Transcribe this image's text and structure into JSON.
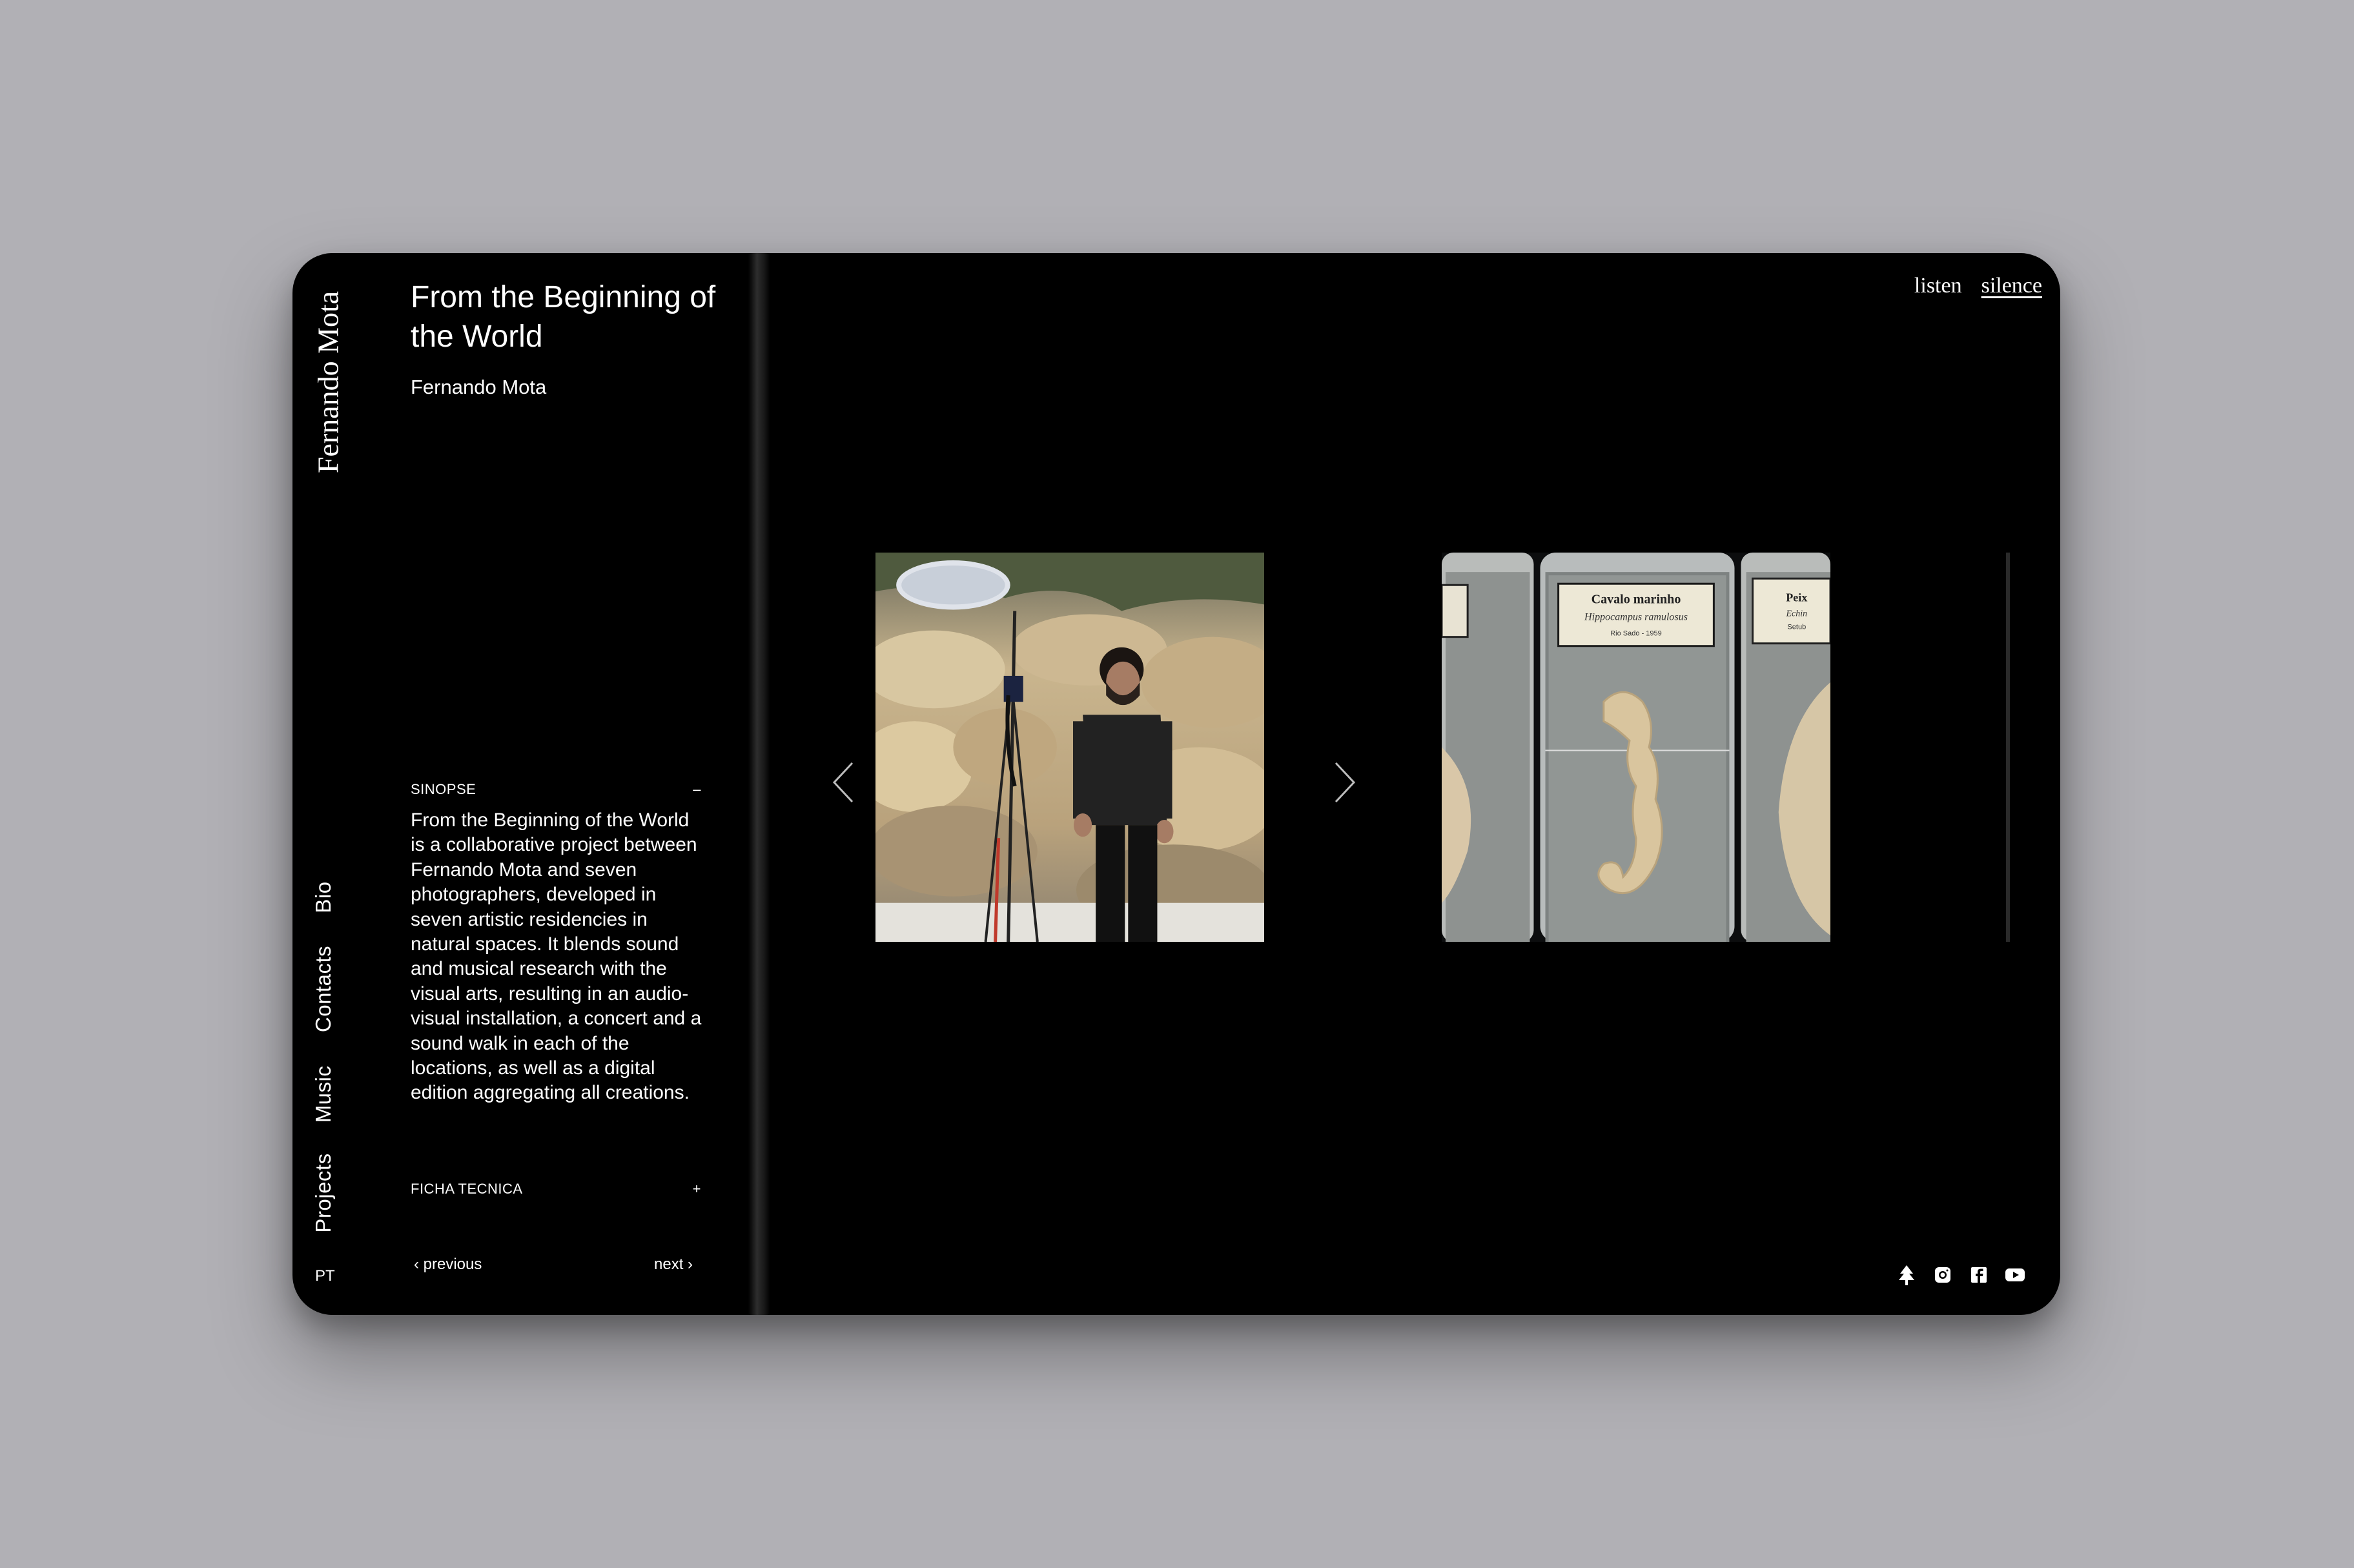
{
  "sidebar": {
    "brand": "Fernando Mota",
    "nav": [
      {
        "label": "Bio"
      },
      {
        "label": "Contacts"
      },
      {
        "label": "Music"
      },
      {
        "label": "Projects"
      }
    ],
    "language": "PT"
  },
  "project": {
    "title": "From the Beginning of the World",
    "author": "Fernando Mota",
    "sinopse": {
      "heading": "SINOPSE",
      "toggle": "–",
      "text": "From the Beginning of the World is a collaborative project between Fernando Mota and seven photographers, developed in seven artistic residencies in natural spaces. It blends sound and musical research with the visual arts, resulting in an audio-visual installation, a concert and a sound walk in each of the locations, as well as a digital edition aggregating all creations."
    },
    "ficha": {
      "heading": "FICHA TECNICA",
      "toggle": "+"
    },
    "pager": {
      "previous": "‹ previous",
      "next": "next ›"
    }
  },
  "top_links": {
    "listen": "listen",
    "silence": "silence"
  },
  "gallery": {
    "jar_label_title": "Cavalo marinho",
    "jar_label_species": "Hippocampus ramulosus",
    "jar_label_place": "Rio Sado - 1959",
    "side_jar_label_title": "Peix",
    "side_jar_label_species": "Echin",
    "side_jar_label_place": "Setub"
  },
  "socials": [
    "linktree-icon",
    "instagram-icon",
    "facebook-icon",
    "youtube-icon"
  ],
  "colors": {
    "background": "#b1b0b5",
    "device": "#000000",
    "text": "#ffffff"
  }
}
